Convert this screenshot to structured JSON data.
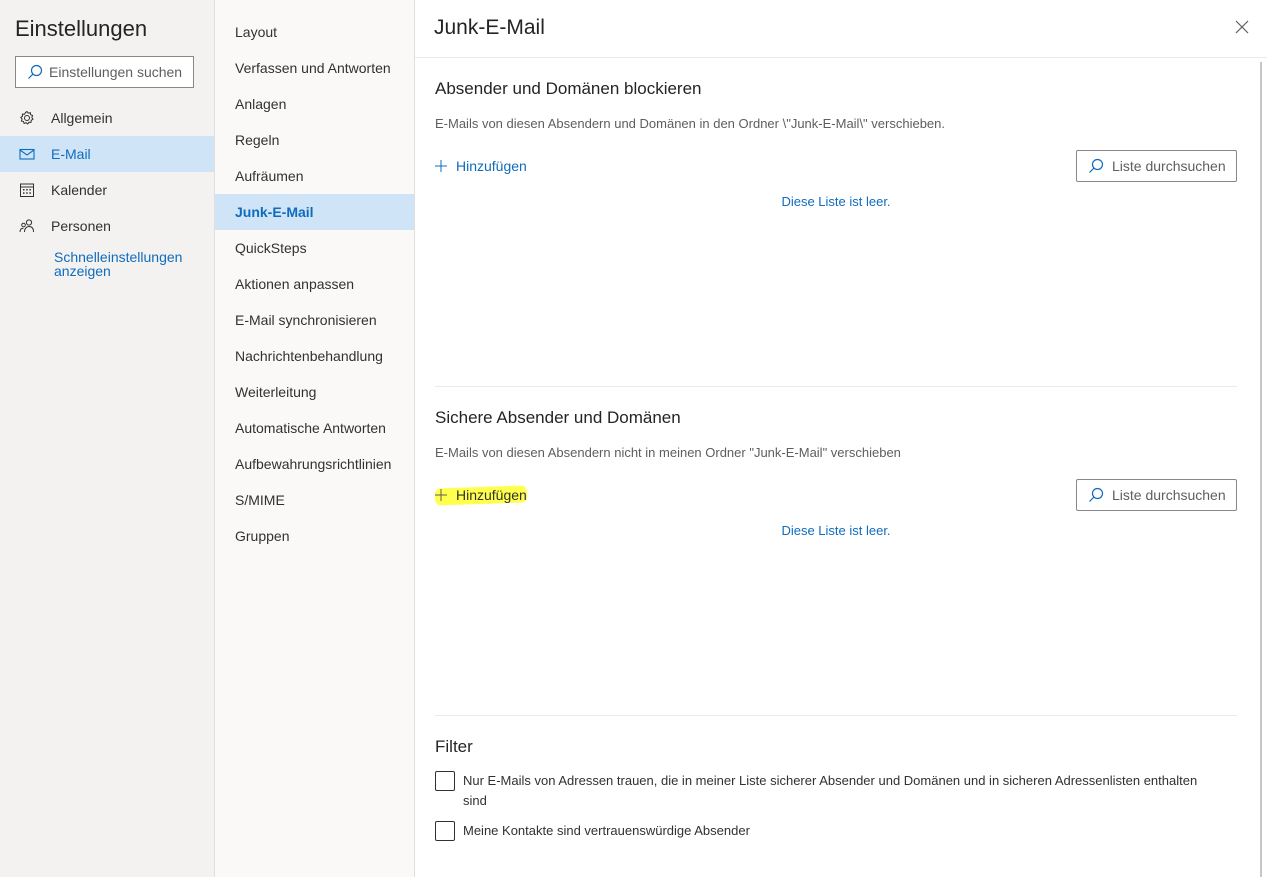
{
  "app": {
    "title": "Einstellungen"
  },
  "search": {
    "placeholder": "Einstellungen suchen"
  },
  "main_nav": [
    {
      "label": "Allgemein",
      "icon": "gear-icon"
    },
    {
      "label": "E-Mail",
      "icon": "mail-icon",
      "active": true
    },
    {
      "label": "Kalender",
      "icon": "calendar-icon"
    },
    {
      "label": "Personen",
      "icon": "people-icon"
    }
  ],
  "quick_settings": {
    "label": "Schnelleinstellungen anzeigen"
  },
  "sub_nav": [
    {
      "label": "Layout"
    },
    {
      "label": "Verfassen und Antworten"
    },
    {
      "label": "Anlagen"
    },
    {
      "label": "Regeln"
    },
    {
      "label": "Aufräumen"
    },
    {
      "label": "Junk-E-Mail",
      "active": true
    },
    {
      "label": "QuickSteps"
    },
    {
      "label": "Aktionen anpassen"
    },
    {
      "label": "E-Mail synchronisieren"
    },
    {
      "label": "Nachrichtenbehandlung"
    },
    {
      "label": "Weiterleitung"
    },
    {
      "label": "Automatische Antworten"
    },
    {
      "label": "Aufbewahrungsrichtlinien"
    },
    {
      "label": "S/MIME"
    },
    {
      "label": "Gruppen"
    }
  ],
  "page": {
    "title": "Junk-E-Mail"
  },
  "blocked": {
    "title": "Absender und Domänen blockieren",
    "description": "E-Mails von diesen Absendern und Domänen in den Ordner \\\"Junk-E-Mail\\\" verschieben.",
    "add_label": "Hinzufügen",
    "search_label": "Liste durchsuchen",
    "empty_text": "Diese Liste ist leer."
  },
  "safe": {
    "title": "Sichere Absender und Domänen",
    "description": "E-Mails von diesen Absendern nicht in meinen Ordner \"Junk-E-Mail\" verschieben",
    "add_label": "Hinzufügen",
    "search_label": "Liste durchsuchen",
    "empty_text": "Diese Liste ist leer."
  },
  "filter": {
    "title": "Filter",
    "options": [
      {
        "label": "Nur E-Mails von Adressen trauen, die in meiner Liste sicherer Absender und Domänen und in sicheren Adressenlisten enthalten sind",
        "checked": false
      },
      {
        "label": "Meine Kontakte sind vertrauenswürdige Absender",
        "checked": false
      }
    ]
  },
  "colors": {
    "accent": "#0f6cbd",
    "nav_active_bg": "#cfe4f7",
    "annotation_highlight": "#ffff3b"
  }
}
